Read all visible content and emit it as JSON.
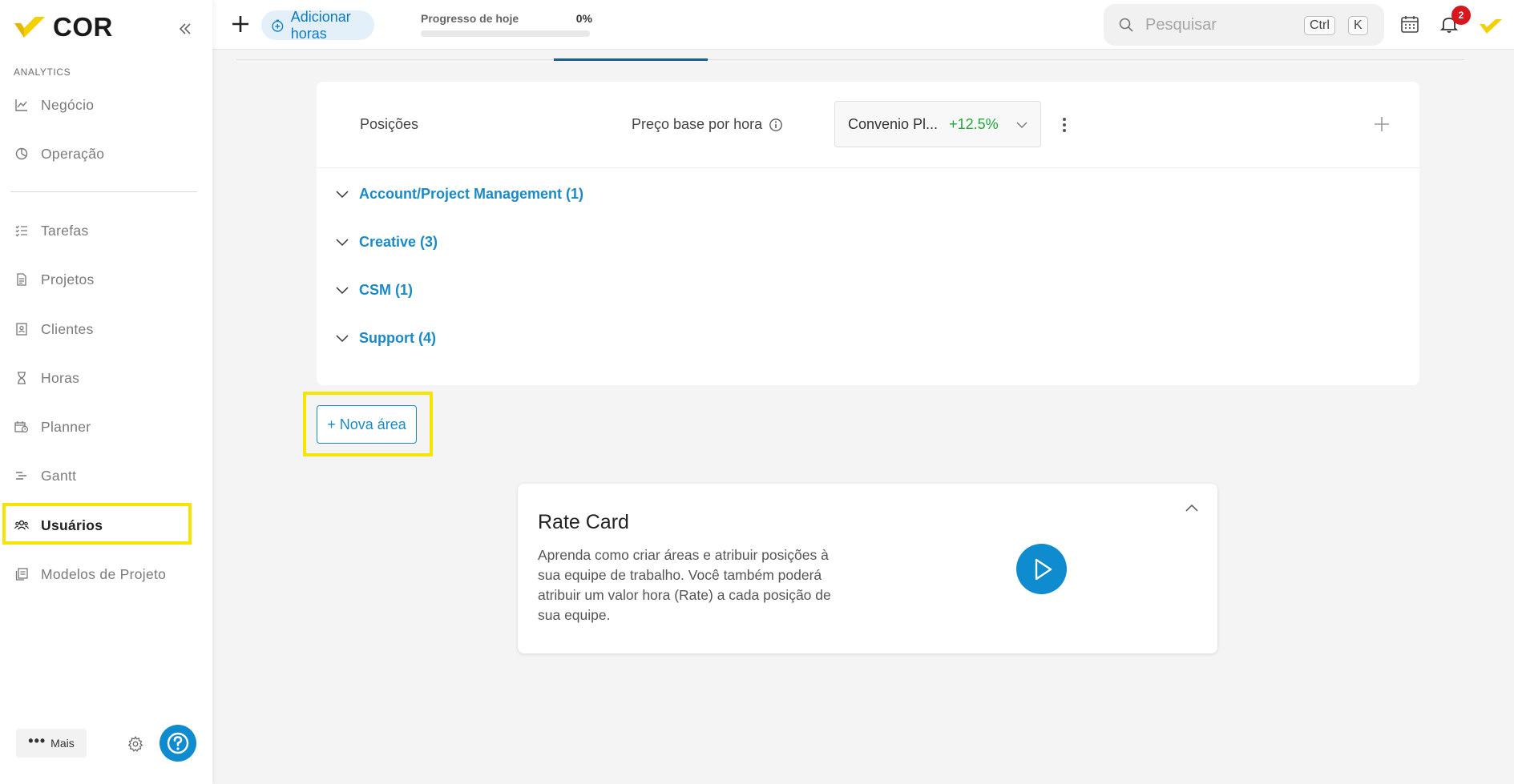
{
  "brand": {
    "name": "COR",
    "accent": "#f5d000",
    "primary": "#0e8ccf"
  },
  "sidebar": {
    "section_title": "ANALYTICS",
    "items": [
      {
        "label": "Negócio",
        "icon": "chart-line-icon"
      },
      {
        "label": "Operação",
        "icon": "pie-chart-icon"
      },
      {
        "label": "Tarefas",
        "icon": "checklist-icon"
      },
      {
        "label": "Projetos",
        "icon": "document-icon"
      },
      {
        "label": "Clientes",
        "icon": "contact-card-icon"
      },
      {
        "label": "Horas",
        "icon": "hourglass-icon"
      },
      {
        "label": "Planner",
        "icon": "calendar-clock-icon"
      },
      {
        "label": "Gantt",
        "icon": "gantt-icon"
      },
      {
        "label": "Usuários",
        "icon": "users-icon",
        "active": true
      },
      {
        "label": "Modelos de Projeto",
        "icon": "templates-icon"
      }
    ],
    "more_label": "Mais"
  },
  "topbar": {
    "add_hours_label": "Adicionar horas",
    "progress_label": "Progresso de hoje",
    "progress_value": "0%",
    "progress_fraction": 0,
    "search_placeholder": "Pesquisar",
    "kbd_ctrl": "Ctrl",
    "kbd_k": "K",
    "notification_count": "2"
  },
  "positions_card": {
    "col_positions": "Posições",
    "col_base_price": "Preço base por hora",
    "select_value": "Convenio Pl...",
    "select_pct": "+12.5%",
    "groups": [
      {
        "label": "Account/Project Management (1)"
      },
      {
        "label": "Creative (3)"
      },
      {
        "label": "CSM (1)"
      },
      {
        "label": "Support (4)"
      }
    ]
  },
  "nova_area_label": "+ Nova área",
  "rate_card": {
    "title": "Rate Card",
    "description": "Aprenda como criar áreas e atribuir posições à sua equipe de trabalho. Você também poderá atribuir um valor hora (Rate) a cada posição de sua equipe."
  }
}
